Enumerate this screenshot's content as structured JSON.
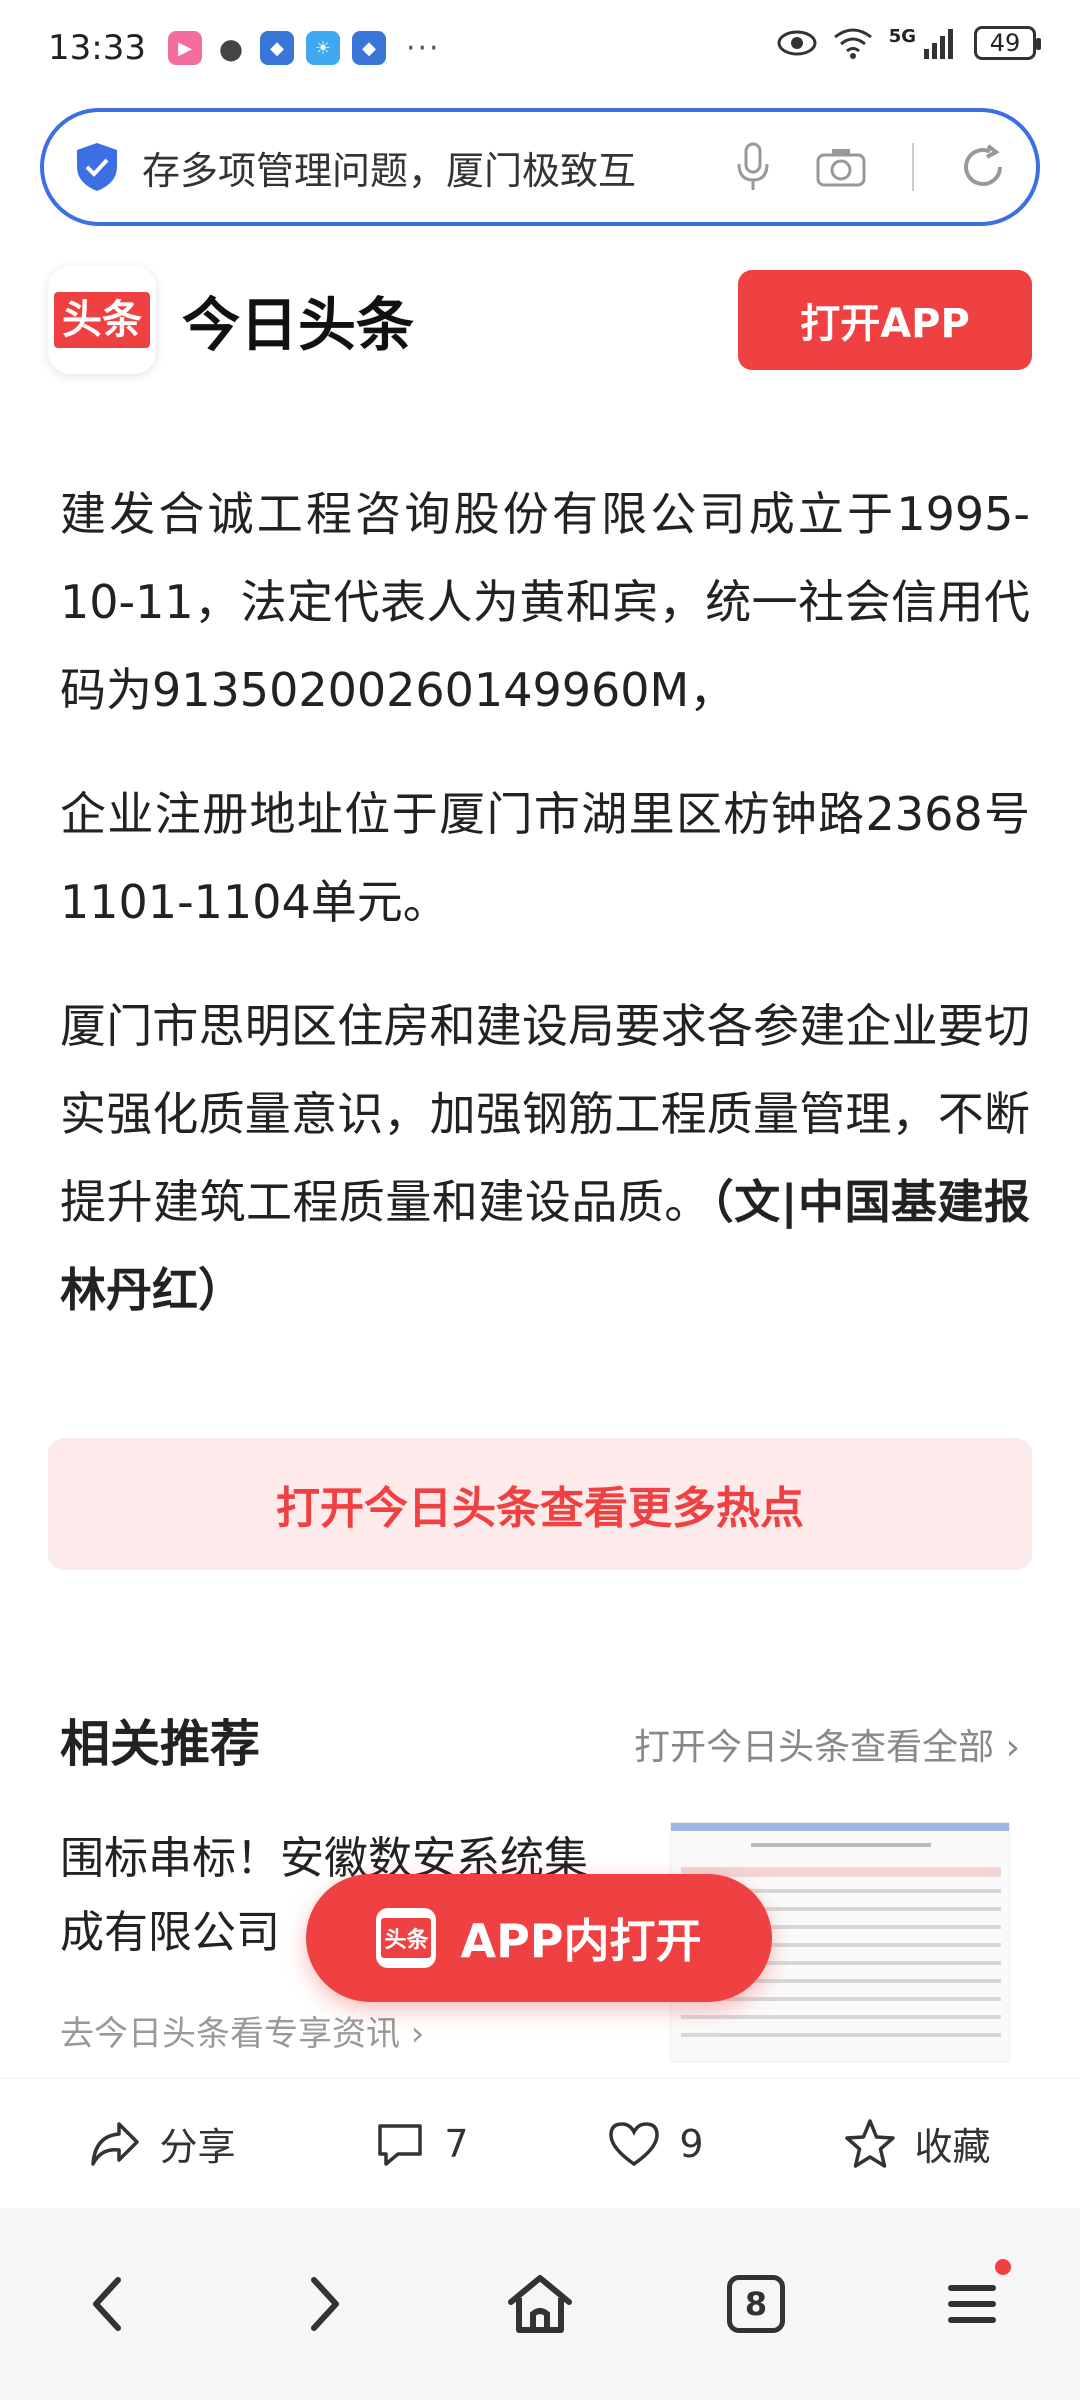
{
  "status": {
    "time": "13:33",
    "more": "···",
    "network": "5G",
    "battery": "49"
  },
  "search": {
    "query": "存多项管理问题，厦门极致互"
  },
  "brand": {
    "logo_text": "头条",
    "name": "今日头条",
    "open_app": "打开APP"
  },
  "article": {
    "paragraphs": [
      "建发合诚工程咨询股份有限公司成立于1995-10-11，法定代表人为黄和宾，统一社会信用代码为91350200260149960M，",
      "企业注册地址位于厦门市湖里区枋钟路2368号1101-1104单元。",
      "厦门市思明区住房和建设局要求各参建企业要切实强化质量意识，加强钢筋工程质量管理，不断提升建筑工程质量和建设品质。"
    ],
    "credit": "（文|中国基建报 林丹红）"
  },
  "more_hot": "打开今日头条查看更多热点",
  "related": {
    "title": "相关推荐",
    "see_all": "打开今日头条查看全部",
    "item": {
      "title": "围标串标！安徽数安系统集成有限公司",
      "subtitle": "去今日头条看专享资讯"
    }
  },
  "float_button": {
    "logo_text": "头条",
    "label": "APP内打开"
  },
  "actions": {
    "share": "分享",
    "comments": "7",
    "likes": "9",
    "favorite": "收藏"
  },
  "nav": {
    "tabs": "8"
  },
  "colors": {
    "brand_red": "#f04142",
    "search_border": "#3b6fe3"
  }
}
